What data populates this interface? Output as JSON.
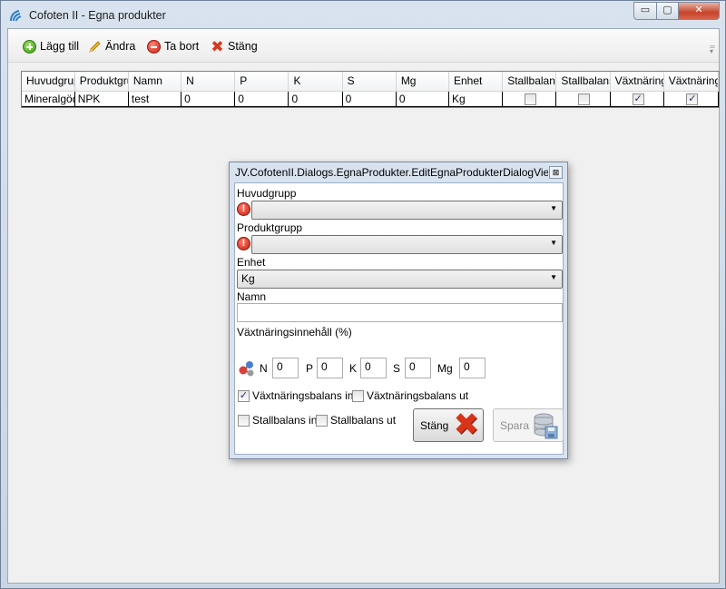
{
  "window": {
    "title": "Cofoten II - Egna produkter",
    "min_glyph": "▭",
    "max_glyph": "▢",
    "close_glyph": "✕"
  },
  "toolbar": {
    "add_label": "Lägg till",
    "edit_label": "Ändra",
    "delete_label": "Ta bort",
    "close_label": "Stäng"
  },
  "grid": {
    "columns": [
      "Huvudgrupp",
      "Produktgrupp",
      "Namn",
      "N",
      "P",
      "K",
      "S",
      "Mg",
      "Enhet",
      "Stallbalans in",
      "Stallbalans ut",
      "Växtnäringsbalans in",
      "Växtnäringsbalans ut"
    ],
    "rows": [
      {
        "huvudgrupp": "Mineralgödsel",
        "produktgrupp": "NPK",
        "namn": "test",
        "n": "0",
        "p": "0",
        "k": "0",
        "s": "0",
        "mg": "0",
        "enhet": "Kg",
        "stall_in": false,
        "stall_ut": false,
        "vaxt_in": true,
        "vaxt_ut": true
      }
    ]
  },
  "dialog": {
    "title": "JV.CofotenII.Dialogs.EgnaProdukter.EditEgnaProdukterDialogViewModel",
    "close_glyph": "⊠",
    "huvudgrupp_label": "Huvudgrupp",
    "huvudgrupp_value": "",
    "produktgrupp_label": "Produktgrupp",
    "produktgrupp_value": "",
    "enhet_label": "Enhet",
    "enhet_value": "Kg",
    "namn_label": "Namn",
    "namn_value": "",
    "content_label": "Växtnäringsinnehåll (%)",
    "n_label": "N",
    "n_value": "0",
    "p_label": "P",
    "p_value": "0",
    "k_label": "K",
    "k_value": "0",
    "s_label": "S",
    "s_value": "0",
    "mg_label": "Mg",
    "mg_value": "0",
    "vaxt_in_label": "Växtnäringsbalans in",
    "vaxt_in_checked": true,
    "vaxt_ut_label": "Växtnäringsbalans ut",
    "vaxt_ut_checked": false,
    "stall_in_label": "Stallbalans in",
    "stall_in_checked": false,
    "stall_ut_label": "Stallbalans ut",
    "stall_ut_checked": false,
    "stang_label": "Stäng",
    "spara_label": "Spara",
    "error_glyph": "!",
    "check_glyph": "✓",
    "arrow_glyph": "▼"
  },
  "icons": {
    "app": "cofoten-logo-icon",
    "add": "add-icon",
    "edit": "pencil-icon",
    "delete": "remove-icon",
    "close": "red-x-icon",
    "molecule": "molecule-icon",
    "save": "database-save-icon"
  },
  "colors": {
    "accent_red": "#d43a1c",
    "accent_green": "#3b9a14",
    "window_frame": "#c9d5e3"
  }
}
